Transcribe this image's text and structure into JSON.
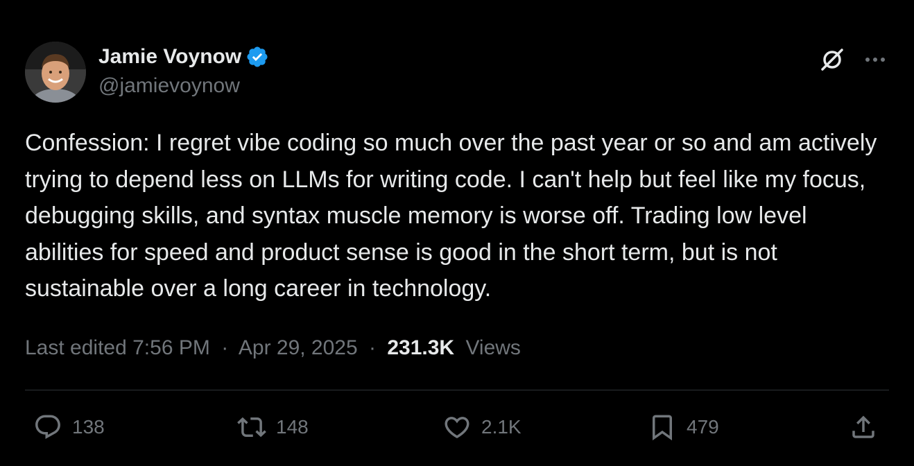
{
  "author": {
    "display_name": "Jamie Voynow",
    "handle": "@jamievoynow",
    "verified": true,
    "verified_color": "#1d9bf0"
  },
  "header_icons": {
    "grok": "grok-icon",
    "more": "more-icon"
  },
  "tweet": {
    "text": "Confession: I regret vibe coding so much over the past year or so and am actively trying to depend less on LLMs for writing code. I can't help but feel like my focus, debugging skills, and syntax muscle memory is worse off. Trading low level abilities for speed and product sense is good in the short term, but is not sustainable over a long career in technology."
  },
  "meta": {
    "edited_label": "Last edited 7:56 PM",
    "separator": "·",
    "date": "Apr 29, 2025",
    "views_count": "231.3K",
    "views_label": "Views"
  },
  "actions": {
    "replies": "138",
    "reposts": "148",
    "likes": "2.1K",
    "bookmarks": "479"
  },
  "colors": {
    "background": "#000000",
    "text_primary": "#e7e9ea",
    "text_secondary": "#71767b",
    "divider": "#2f3336"
  }
}
